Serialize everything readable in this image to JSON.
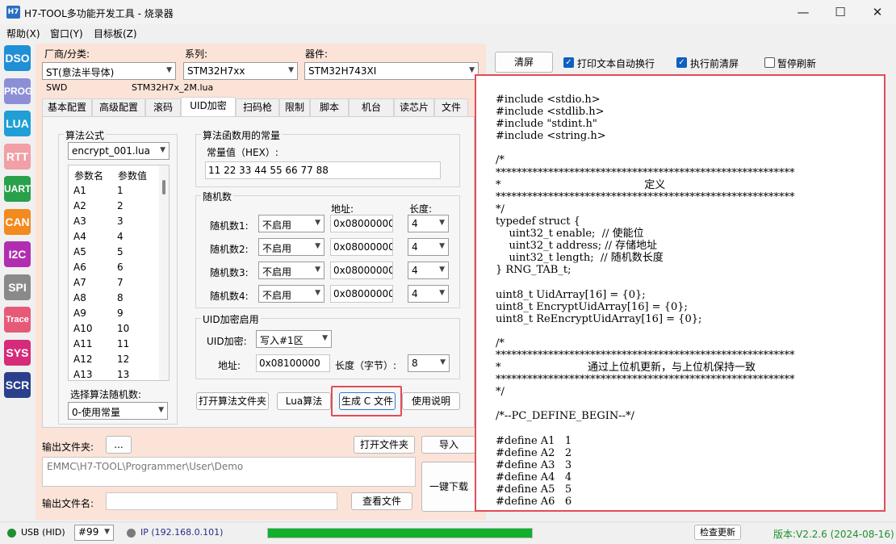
{
  "window": {
    "title": "H7-TOOL多功能开发工具 - 烧录器",
    "icon_text": "H7"
  },
  "menu": [
    "帮助(X)",
    "窗口(Y)",
    "目标板(Z)"
  ],
  "sidebar": [
    {
      "label": "DSO",
      "color": "#1f8fd6"
    },
    {
      "label": "PROG",
      "color": "#8c8fd8"
    },
    {
      "label": "LUA",
      "color": "#1f9fd6"
    },
    {
      "label": "RTT",
      "color": "#f0a0a6"
    },
    {
      "label": "UART",
      "color": "#29a04c"
    },
    {
      "label": "CAN",
      "color": "#f28a1e"
    },
    {
      "label": "I2C",
      "color": "#b12eb0"
    },
    {
      "label": "SPI",
      "color": "#8a8a8a"
    },
    {
      "label": "Trace",
      "color": "#e65a78"
    },
    {
      "label": "SYS",
      "color": "#d62a7a"
    },
    {
      "label": "SCR",
      "color": "#2c3f8c"
    }
  ],
  "device": {
    "vendor_label": "厂商/分类:",
    "vendor": "ST(意法半导体)",
    "series_label": "系列:",
    "series": "STM32H7xx",
    "part_label": "器件:",
    "part": "STM32H743XI",
    "interface": "SWD",
    "algo_file": "STM32H7x_2M.lua"
  },
  "tabs": [
    "基本配置",
    "高级配置",
    "滚码",
    "UID加密",
    "扫码枪",
    "限制",
    "脚本",
    "机台",
    "读芯片",
    "文件"
  ],
  "uid": {
    "algo_group": "算法公式",
    "algo_file": "encrypt_001.lua",
    "param_header": [
      "参数名",
      "参数值"
    ],
    "params": [
      [
        "A1",
        "1"
      ],
      [
        "A2",
        "2"
      ],
      [
        "A3",
        "3"
      ],
      [
        "A4",
        "4"
      ],
      [
        "A5",
        "5"
      ],
      [
        "A6",
        "6"
      ],
      [
        "A7",
        "7"
      ],
      [
        "A8",
        "8"
      ],
      [
        "A9",
        "9"
      ],
      [
        "A10",
        "10"
      ],
      [
        "A11",
        "11"
      ],
      [
        "A12",
        "12"
      ],
      [
        "A13",
        "13"
      ]
    ],
    "rand_select_label": "选择算法随机数:",
    "rand_select": "0-使用常量",
    "const_group": "算法函数用的常量",
    "const_label": "常量值（HEX）:",
    "const_value": "11 22 33 44 55 66 77 88",
    "rand_group": "随机数",
    "addr_header": "地址:",
    "len_header": "长度:",
    "randoms": [
      {
        "label": "随机数1:",
        "mode": "不启用",
        "addr": "0x08000000",
        "len": "4"
      },
      {
        "label": "随机数2:",
        "mode": "不启用",
        "addr": "0x08000000",
        "len": "4"
      },
      {
        "label": "随机数3:",
        "mode": "不启用",
        "addr": "0x08000000",
        "len": "4"
      },
      {
        "label": "随机数4:",
        "mode": "不启用",
        "addr": "0x08000000",
        "len": "4"
      }
    ],
    "enable_group": "UID加密启用",
    "uid_label": "UID加密:",
    "uid_mode": "写入#1区",
    "addr_label": "地址:",
    "addr_value": "0x08100000",
    "len_label": "长度（字节）:",
    "len_value": "8",
    "buttons": [
      "打开算法文件夹",
      "Lua算法",
      "生成 C 文件",
      "使用说明"
    ]
  },
  "output": {
    "folder_label": "输出文件夹:",
    "browse": "...",
    "open_folder": "打开文件夹",
    "import": "导入",
    "path": "EMMC\\H7-TOOL\\Programmer\\User\\Demo",
    "name_label": "输出文件名:",
    "name_value": "",
    "view_file": "查看文件",
    "download": "一键下载"
  },
  "right": {
    "clear": "清屏",
    "wrap": "打印文本自动换行",
    "clear_before": "执行前清屏",
    "pause": "暂停刷新",
    "code": "#include <stdio.h>\n#include <stdlib.h>\n#include \"stdint.h\"\n#include <string.h>\n\n/*\n*********************************************************\n*                                           定义\n*********************************************************\n*/\ntypedef struct {\n    uint32_t enable;  // 使能位\n    uint32_t address; // 存储地址\n    uint32_t length;  // 随机数长度\n} RNG_TAB_t;\n\nuint8_t UidArray[16] = {0};\nuint8_t EncryptUidArray[16] = {0};\nuint8_t ReEncryptUidArray[16] = {0};\n\n/*\n*********************************************************\n*                          通过上位机更新，与上位机保持一致\n*********************************************************\n*/\n\n/*--PC_DEFINE_BEGIN--*/\n\n#define A1   1\n#define A2   2\n#define A3   3\n#define A4   4\n#define A5   5\n#define A6   6"
  },
  "status": {
    "usb": "USB (HID)",
    "port": "#99",
    "ip": "IP (192.168.0.101)",
    "progress": 1.0,
    "check_update": "检查更新",
    "version": "版本:V2.2.6 (2024-08-16)"
  }
}
